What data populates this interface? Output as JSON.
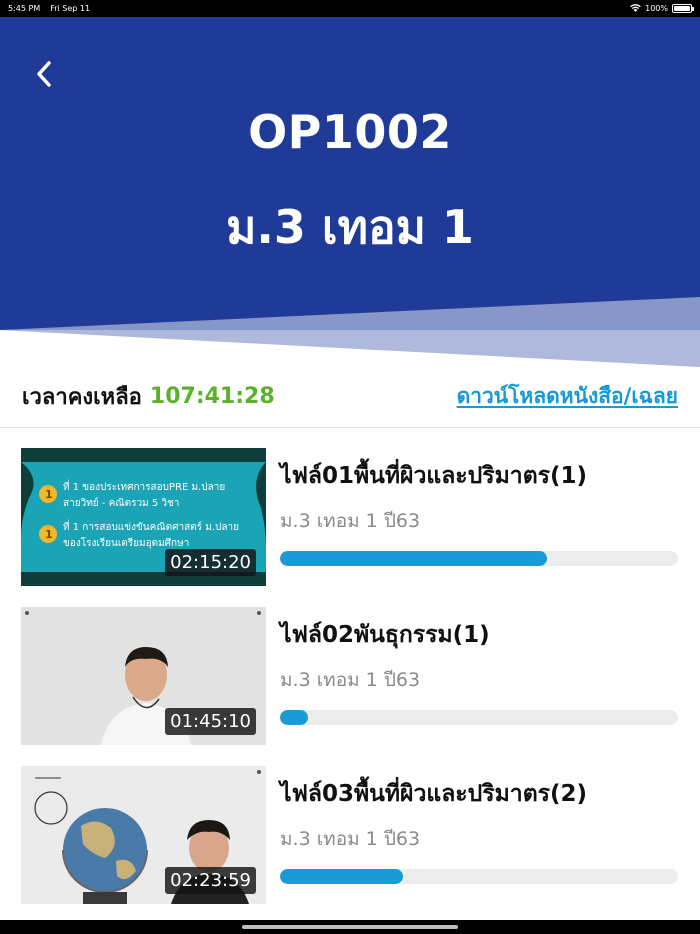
{
  "status_bar": {
    "time": "5:45 PM",
    "date": "Fri Sep 11",
    "battery": "100%"
  },
  "header": {
    "course_code": "OP1002",
    "course_name": "ม.3 เทอม 1"
  },
  "info": {
    "time_remaining_label": "เวลาคงเหลือ",
    "time_remaining_value": "107:41:28",
    "download_link": "ดาวน์โหลดหนังสือ/เฉลย"
  },
  "videos": [
    {
      "title": "ไฟล์01พื้นที่ผิวและปริมาตร(1)",
      "subtitle": "ม.3 เทอม 1 ปี63",
      "duration": "02:15:20",
      "progress": 0.67,
      "thumb_text_1": "ที่ 1 ของประเทศการสอบPRE ม.ปลาย",
      "thumb_text_2": "สายวิทย์ - คณิตรวม 5 วิชา",
      "thumb_text_3": "ที่ 1 การสอบแข่งขันคณิตศาสตร์ ม.ปลาย",
      "thumb_text_4": "ของโรงเรียนเตรียมอุดมศึกษา"
    },
    {
      "title": "ไฟล์02พันธุกรรม(1)",
      "subtitle": "ม.3 เทอม 1 ปี63",
      "duration": "01:45:10",
      "progress": 0.07
    },
    {
      "title": "ไฟล์03พื้นที่ผิวและปริมาตร(2)",
      "subtitle": "ม.3 เทอม 1 ปี63",
      "duration": "02:23:59",
      "progress": 0.31
    }
  ],
  "colors": {
    "header_bg": "#1f3b97",
    "accent_green": "#5cb12c",
    "link_blue": "#1699d4",
    "progress_blue": "#1a9bd6"
  }
}
